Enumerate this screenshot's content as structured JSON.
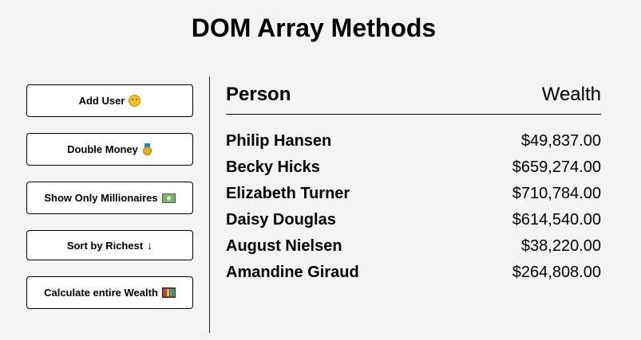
{
  "page": {
    "title": "DOM Array Methods"
  },
  "sidebar": {
    "buttons": [
      {
        "label": "Add User",
        "icon": "face-emoji-icon"
      },
      {
        "label": "Double Money",
        "icon": "medal-emoji-icon"
      },
      {
        "label": "Show Only Millionaires",
        "icon": "money-bills-emoji-icon"
      },
      {
        "label": "Sort by Richest",
        "icon": "down-arrow-icon",
        "glyph": "↓"
      },
      {
        "label": "Calculate entire Wealth",
        "icon": "abacus-emoji-icon"
      }
    ]
  },
  "table": {
    "header": {
      "person": "Person",
      "wealth": "Wealth"
    },
    "rows": [
      {
        "name": "Philip Hansen",
        "wealth": "$49,837.00"
      },
      {
        "name": "Becky Hicks",
        "wealth": "$659,274.00"
      },
      {
        "name": "Elizabeth Turner",
        "wealth": "$710,784.00"
      },
      {
        "name": "Daisy Douglas",
        "wealth": "$614,540.00"
      },
      {
        "name": "August Nielsen",
        "wealth": "$38,220.00"
      },
      {
        "name": "Amandine Giraud",
        "wealth": "$264,808.00"
      }
    ]
  },
  "colors": {
    "background": "#f4f4f4",
    "button_background": "#ffffff",
    "text": "#000000"
  }
}
